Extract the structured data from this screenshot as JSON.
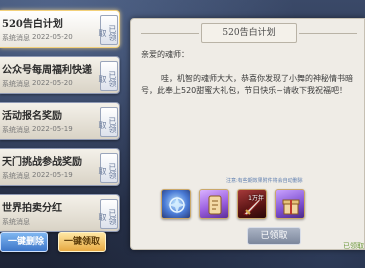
{
  "mails": [
    {
      "title": "520告白计划",
      "sender": "系统消息",
      "date": "2022-05-20",
      "stamp": "已领取"
    },
    {
      "title": "公众号每周福利快递",
      "sender": "系统消息",
      "date": "2022-05-20",
      "stamp": "已领取"
    },
    {
      "title": "活动报名奖励",
      "sender": "系统消息",
      "date": "2022-05-19",
      "stamp": "已领取"
    },
    {
      "title": "天门挑战参战奖励",
      "sender": "系统消息",
      "date": "2022-05-19",
      "stamp": "已领取"
    },
    {
      "title": "世界拍卖分红",
      "sender": "系统消息",
      "date": "",
      "stamp": "已领取"
    }
  ],
  "buttons": {
    "delete_all": "一键删除",
    "claim_all": "一键领取",
    "claimed": "已领取"
  },
  "detail": {
    "title": "520告白计划",
    "greeting": "亲爱的魂师：",
    "body": "哇，机智的魂师大大，恭喜你发现了小舞的神秘情书暗号，此奉上520甜蜜大礼包，节日快乐~请收下我祝福吧！",
    "note": "注意:有些期效果附件将会自动删除",
    "claimed_note": "已领取"
  },
  "rewards": [
    {
      "icon": "blue-spirit-orb-icon",
      "count": ""
    },
    {
      "icon": "scroll-icon",
      "count": ""
    },
    {
      "icon": "red-sword-icon",
      "count": "1万年"
    },
    {
      "icon": "gift-box-icon",
      "count": ""
    }
  ],
  "colors": {
    "selected_border": "#f2d07a",
    "delete_button": "#3d76c9",
    "claim_button": "#e7a942",
    "claimed_text": "#6f9a3f"
  }
}
